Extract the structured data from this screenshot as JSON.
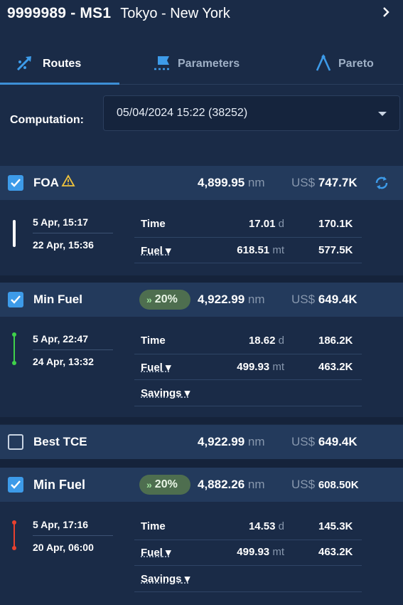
{
  "header": {
    "vessel_id": "9999989 - MS1",
    "route": "Tokyo - New York",
    "nav_icon": "chevron-right-icon"
  },
  "tabs": [
    {
      "label": "Routes",
      "icon": "route-icon",
      "active": true
    },
    {
      "label": "Parameters",
      "icon": "flag-icon",
      "active": false
    },
    {
      "label": "Pareto",
      "icon": "compass-icon",
      "active": false
    }
  ],
  "computation": {
    "label": "Computation:",
    "value": "05/04/2024 15:22 (38252)"
  },
  "colors": {
    "accent": "#3d9be9",
    "background": "#1a2b47",
    "row_header": "#233a5c",
    "badge": "#4e6e4f",
    "timeline_white": "#ffffff",
    "timeline_green": "#3fd14a",
    "timeline_red": "#e8412f"
  },
  "routes": [
    {
      "name": "FOA",
      "checked": true,
      "warning": true,
      "refresh": true,
      "badge": "",
      "distance": "4,899.95",
      "distance_unit": "nm",
      "currency": "US$",
      "cost": "747.7K",
      "timeline_color": "white",
      "start": "5 Apr, 15:17",
      "end": "22 Apr, 15:36",
      "metrics": [
        {
          "label": "Time",
          "value": "17.01",
          "unit": "d",
          "cost": "170.1K",
          "dropdown": false
        },
        {
          "label": "Fuel",
          "value": "618.51",
          "unit": "mt",
          "cost": "577.5K",
          "dropdown": true
        }
      ]
    },
    {
      "name": "Min Fuel",
      "checked": true,
      "warning": false,
      "refresh": false,
      "badge": "20%",
      "distance": "4,922.99",
      "distance_unit": "nm",
      "currency": "US$",
      "cost": "649.4K",
      "timeline_color": "green",
      "start": "5 Apr, 22:47",
      "end": "24 Apr, 13:32",
      "metrics": [
        {
          "label": "Time",
          "value": "18.62",
          "unit": "d",
          "cost": "186.2K",
          "dropdown": false
        },
        {
          "label": "Fuel",
          "value": "499.93",
          "unit": "mt",
          "cost": "463.2K",
          "dropdown": true
        },
        {
          "label": "Savings",
          "value": "",
          "unit": "",
          "cost": "",
          "dropdown": true
        }
      ]
    },
    {
      "name": "Best TCE",
      "checked": false,
      "warning": false,
      "refresh": false,
      "badge": "",
      "distance": "4,922.99",
      "distance_unit": "nm",
      "currency": "US$",
      "cost": "649.4K"
    },
    {
      "name": "Min Fuel",
      "checked": true,
      "warning": false,
      "refresh": false,
      "badge": "20%",
      "distance": "4,882.26",
      "distance_unit": "nm",
      "currency": "US$",
      "cost": "608.50K",
      "timeline_color": "red",
      "start": "5 Apr, 17:16",
      "end": "20 Apr, 06:00",
      "metrics": [
        {
          "label": "Time",
          "value": "14.53",
          "unit": "d",
          "cost": "145.3K",
          "dropdown": false
        },
        {
          "label": "Fuel",
          "value": "499.93",
          "unit": "mt",
          "cost": "463.2K",
          "dropdown": true
        },
        {
          "label": "Savings",
          "value": "",
          "unit": "",
          "cost": "",
          "dropdown": true
        }
      ]
    }
  ]
}
